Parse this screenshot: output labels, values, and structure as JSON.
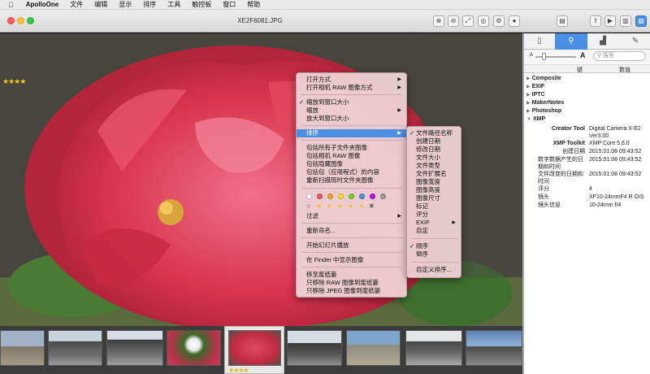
{
  "menubar": {
    "apple": "",
    "app_name": "ApolloOne",
    "items": [
      "文件",
      "编辑",
      "显示",
      "排序",
      "工具",
      "触控板",
      "窗口",
      "帮助"
    ]
  },
  "window": {
    "title": "XE2F6081.JPG"
  },
  "photo": {
    "rating_stars": "★★★★"
  },
  "context_menu": {
    "items": [
      "打开方式",
      "打开相机 RAW 图像方式",
      "缩放到窗口大小",
      "缩放",
      "放大到窗口大小",
      "排序",
      "包括所有子文件夹图像",
      "包括相机 RAW 图像",
      "包括隐藏图像",
      "包括包（应用程式）的内容",
      "重新扫描现时文件夹图像",
      "过滤",
      "重新命名...",
      "开始幻灯片播放",
      "在 Finder 中显示图像",
      "移至废纸篓",
      "只移除 RAW 图像到废纸篓",
      "只移除 JPEG 图像到废纸篓"
    ],
    "checked_index": 2,
    "highlighted_index": 5,
    "color_labels": [
      "#ffffff",
      "#f05a5a",
      "#f5a623",
      "#f8e71c",
      "#7ed321",
      "#4a90e2",
      "#bd10e0",
      "#9b9b9b"
    ],
    "rating_stars": [
      "☆",
      "★",
      "★",
      "★",
      "★",
      "★",
      "✖"
    ]
  },
  "sort_submenu": {
    "items": [
      "文件路径名称",
      "创建日期",
      "修改日期",
      "文件大小",
      "文件类型",
      "文件扩展名",
      "图像宽度",
      "图像高度",
      "图像尺寸",
      "标记",
      "评分",
      "EXIF",
      "自定",
      "顺序",
      "倒序",
      "自定义排序..."
    ],
    "checked": [
      0,
      13
    ]
  },
  "inspector": {
    "tabs": [
      "file-icon",
      "search-icon",
      "color-icon",
      "edit-icon"
    ],
    "zoom_small": "A",
    "zoom_large": "A",
    "search_placeholder": "搜索",
    "col_key": "键",
    "col_value": "数值",
    "groups": [
      {
        "name": "Composite",
        "expanded": false
      },
      {
        "name": "EXIF",
        "expanded": false
      },
      {
        "name": "IPTC",
        "expanded": false
      },
      {
        "name": "MakerNotes",
        "expanded": false
      },
      {
        "name": "Photoshop",
        "expanded": false
      },
      {
        "name": "XMP",
        "expanded": true
      }
    ],
    "xmp_rows": [
      {
        "k": "Creator Tool",
        "v": "Digital Camera X-E2 Ver3.00",
        "bold": true
      },
      {
        "k": "XMP Toolkit",
        "v": "XMP Core 5.6.0",
        "bold": true
      },
      {
        "k": "创建日期",
        "v": "2015:01:08 09:43:52",
        "bold": false
      },
      {
        "k": "数字数据产生的日期和时间",
        "v": "2015:01:08 09:43:52",
        "bold": false
      },
      {
        "k": "文件改变的日期和时间",
        "v": "2015:01:08 09:43:52",
        "bold": false
      },
      {
        "k": "评分",
        "v": "4",
        "bold": false
      },
      {
        "k": "镜头",
        "v": "XF10-24mmF4 R OIS",
        "bold": false
      },
      {
        "k": "镜头信息",
        "v": "10-24mm f/4",
        "bold": false
      }
    ]
  },
  "colors": {
    "accent": "#4a90e2",
    "photo_red": "#d3334b",
    "traffic_close": "#fc605b",
    "traffic_min": "#fdbc40",
    "traffic_max": "#34c84a"
  }
}
